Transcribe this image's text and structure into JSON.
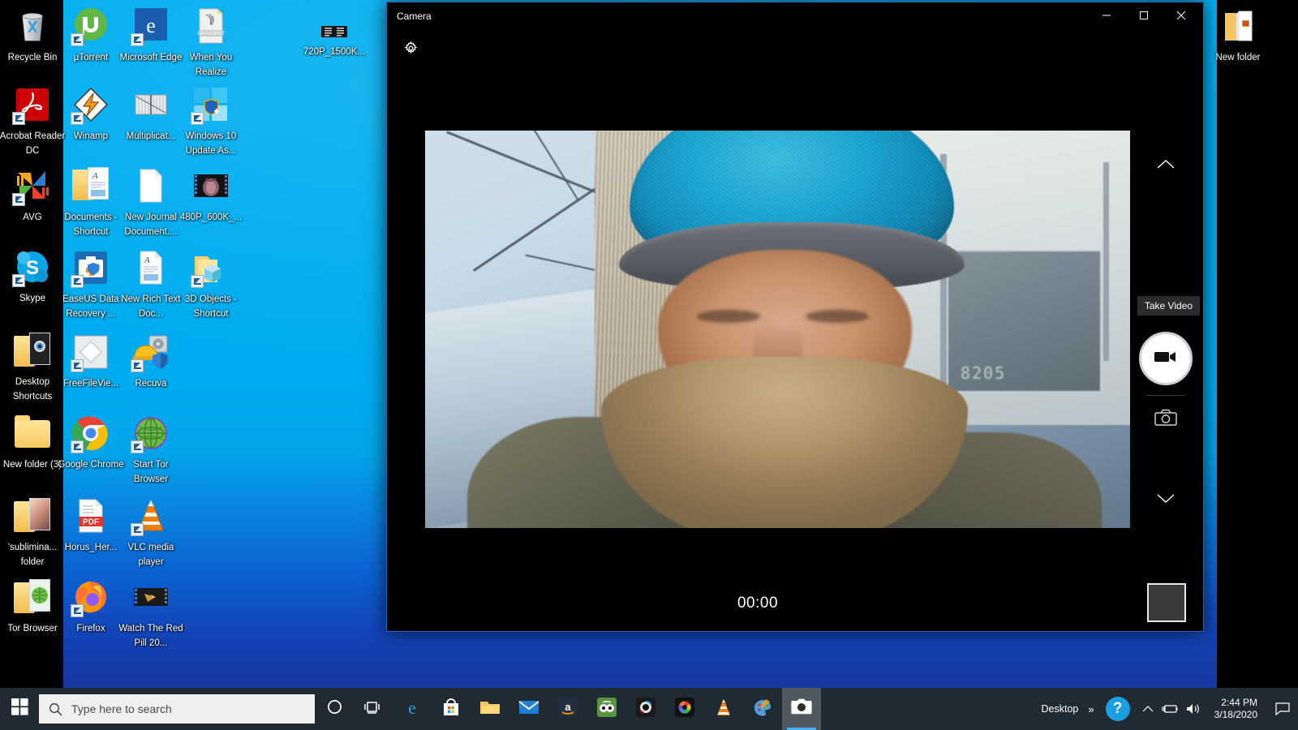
{
  "desktop": {
    "wallpaper_color": "#00aef0",
    "icons_column_left": [
      {
        "label": "Recycle Bin",
        "icon": "recycle-bin-icon",
        "shortcut": false
      },
      {
        "label": "Acrobat Reader DC",
        "icon": "acrobat-reader-icon",
        "shortcut": true
      },
      {
        "label": "AVG",
        "icon": "avg-icon",
        "shortcut": true
      },
      {
        "label": "Skype",
        "icon": "skype-icon",
        "shortcut": true
      },
      {
        "label": "Desktop Shortcuts",
        "icon": "folder-desktop-shortcuts-icon",
        "shortcut": false
      },
      {
        "label": "New folder (3)",
        "icon": "folder-icon",
        "shortcut": false
      },
      {
        "label": "'sublimina... folder",
        "icon": "folder-subliminal-icon",
        "shortcut": false
      },
      {
        "label": "Tor Browser",
        "icon": "folder-tor-browser-icon",
        "shortcut": false
      }
    ],
    "icons_column_2": [
      {
        "label": "µTorrent",
        "icon": "utorrent-icon",
        "shortcut": true
      },
      {
        "label": "Winamp",
        "icon": "winamp-icon",
        "shortcut": true
      },
      {
        "label": "Documents - Shortcut",
        "icon": "documents-folder-icon",
        "shortcut": true
      },
      {
        "label": "EaseUS Data Recovery ...",
        "icon": "easeus-data-recovery-icon",
        "shortcut": true
      },
      {
        "label": "FreeFileVie...",
        "icon": "freefileviewer-icon",
        "shortcut": true
      },
      {
        "label": "Google Chrome",
        "icon": "google-chrome-icon",
        "shortcut": true
      },
      {
        "label": "Horus_Her...",
        "icon": "pdf-document-icon",
        "shortcut": false
      },
      {
        "label": "Firefox",
        "icon": "firefox-icon",
        "shortcut": true
      }
    ],
    "icons_column_3": [
      {
        "label": "Microsoft Edge",
        "icon": "microsoft-edge-icon",
        "shortcut": true
      },
      {
        "label": "Multiplicat...",
        "icon": "image-file-icon",
        "shortcut": false
      },
      {
        "label": "New Journal Document....",
        "icon": "blank-document-icon",
        "shortcut": false
      },
      {
        "label": "New Rich Text Doc...",
        "icon": "rich-text-document-icon",
        "shortcut": false
      },
      {
        "label": "Recuva",
        "icon": "recuva-icon",
        "shortcut": true
      },
      {
        "label": "Start Tor Browser",
        "icon": "tor-browser-icon",
        "shortcut": true
      },
      {
        "label": "VLC media player",
        "icon": "vlc-media-player-icon",
        "shortcut": true
      },
      {
        "label": "Watch The Red Pill 20...",
        "icon": "video-file-icon",
        "shortcut": false
      }
    ],
    "icons_column_4": [
      {
        "label": "When You Realize",
        "icon": "gradient-image-icon",
        "shortcut": false
      },
      {
        "label": "Windows 10 Update As...",
        "icon": "windows-10-update-assistant-icon",
        "shortcut": true
      },
      {
        "label": "480P_600K_...",
        "icon": "video-file-icon",
        "shortcut": false
      },
      {
        "label": "3D Objects - Shortcut",
        "icon": "3d-objects-folder-icon",
        "shortcut": true
      }
    ],
    "icons_column_5": [
      {
        "label": "720P_1500K...",
        "icon": "video-file-icon",
        "shortcut": false
      }
    ],
    "icons_right": [
      {
        "label": "New folder",
        "icon": "folder-open-icon",
        "shortcut": false
      }
    ]
  },
  "camera_window": {
    "title": "Camera",
    "settings_icon": "gear-icon",
    "minimize_label": "—",
    "maximize_label": "□",
    "close_label": "✕",
    "timer": "00:00",
    "tooltip": "Take Video",
    "video_button_icon": "video-camera-icon",
    "photo_button_icon": "camera-icon",
    "scroll_up_icon": "chevron-up-icon",
    "scroll_down_icon": "chevron-down-icon",
    "thumbnail_label": "last-capture-thumbnail"
  },
  "taskbar": {
    "start_icon": "windows-start-icon",
    "search_placeholder": "Type here to search",
    "search_icon": "search-icon",
    "buttons": [
      {
        "name": "cortana-button",
        "icon": "cortana-circle-icon",
        "active": false
      },
      {
        "name": "task-view-button",
        "icon": "task-view-icon",
        "active": false
      },
      {
        "name": "microsoft-edge-button",
        "icon": "microsoft-edge-icon",
        "active": false
      },
      {
        "name": "microsoft-store-button",
        "icon": "microsoft-store-icon",
        "active": false
      },
      {
        "name": "file-explorer-button",
        "icon": "file-explorer-icon",
        "active": false
      },
      {
        "name": "mail-button",
        "icon": "mail-icon",
        "active": false
      },
      {
        "name": "amazon-button",
        "icon": "amazon-icon",
        "active": false
      },
      {
        "name": "tripadvisor-button",
        "icon": "tripadvisor-icon",
        "active": false
      },
      {
        "name": "webcam-app-button",
        "icon": "webcam-dark-icon",
        "active": false
      },
      {
        "name": "color-camera-button",
        "icon": "color-lens-camera-icon",
        "active": false
      },
      {
        "name": "vlc-button",
        "icon": "vlc-cone-icon",
        "active": false
      },
      {
        "name": "paint-3d-button",
        "icon": "paint-3d-icon",
        "active": false
      },
      {
        "name": "camera-app-button",
        "icon": "camera-icon",
        "active": true
      }
    ],
    "tray": {
      "desktop_label": "Desktop",
      "overflow_icon": "chevron-double-up-icon",
      "help_icon": "help-question-icon",
      "show_hidden_icon": "chevron-up-icon",
      "battery_icon": "battery-charging-icon",
      "volume_icon": "volume-icon",
      "time": "2:44 PM",
      "date": "3/18/2020",
      "action_center_icon": "action-center-icon"
    }
  }
}
